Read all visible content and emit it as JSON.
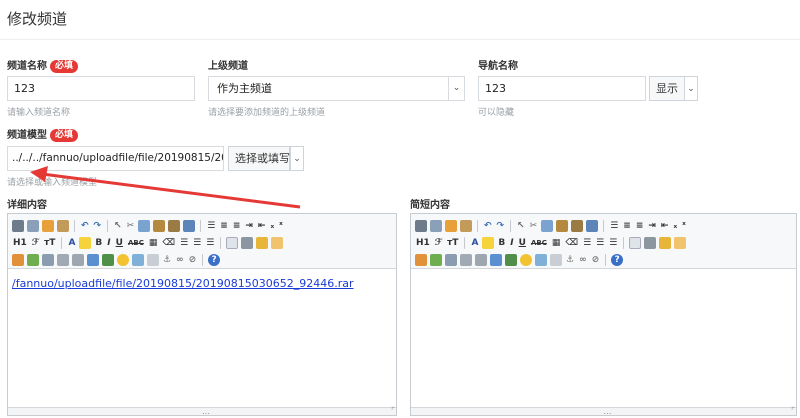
{
  "page": {
    "title": "修改频道"
  },
  "fields": {
    "channel_name": {
      "label": "频道名称",
      "required": "必填",
      "value": "123",
      "hint": "请输入频道名称"
    },
    "parent_channel": {
      "label": "上级频道",
      "value": "作为主频道",
      "hint": "请选择要添加频道的上级频道"
    },
    "nav_name": {
      "label": "导航名称",
      "value": "123",
      "hint": "可以隐藏",
      "display_select": "显示"
    },
    "channel_model": {
      "label": "频道模型",
      "required": "必填",
      "value": "../../../fannuo/uploadfile/file/20190815/201",
      "hint": "请选择或输入频道模型",
      "pick_button": "选择或填写"
    }
  },
  "editors": {
    "detail": {
      "label": "详细内容",
      "content_link": "/fannuo/uploadfile/file/20190815/20190815030652_92446.rar"
    },
    "brief": {
      "label": "简短内容",
      "content_link": ""
    }
  },
  "toolbar_text": {
    "heading": "H1",
    "font": "ℱ",
    "size": "тT",
    "font_color": "A",
    "bold": "B",
    "italic": "I",
    "underline": "U",
    "strike": "ABC",
    "subscript": "ₓ",
    "superscript": "ˣ"
  },
  "colors": {
    "required_badge": "#e53935",
    "link": "#1a3bd6",
    "annotation_arrow": "#e53935"
  }
}
